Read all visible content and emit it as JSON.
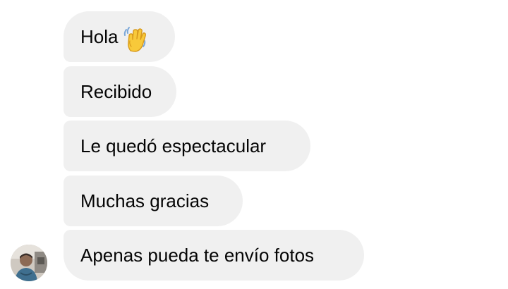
{
  "conversation": {
    "messages": [
      {
        "text": "Hola",
        "emoji": "waving-hand-icon"
      },
      {
        "text": "Recibido"
      },
      {
        "text": "Le quedó espectacular"
      },
      {
        "text": "Muchas gracias"
      },
      {
        "text": "Apenas pueda te envío fotos"
      }
    ]
  },
  "colors": {
    "bubble_background": "#f0f0f0",
    "bubble_text": "#050505",
    "page_background": "#ffffff",
    "emoji_fill": "#f8c93a"
  }
}
